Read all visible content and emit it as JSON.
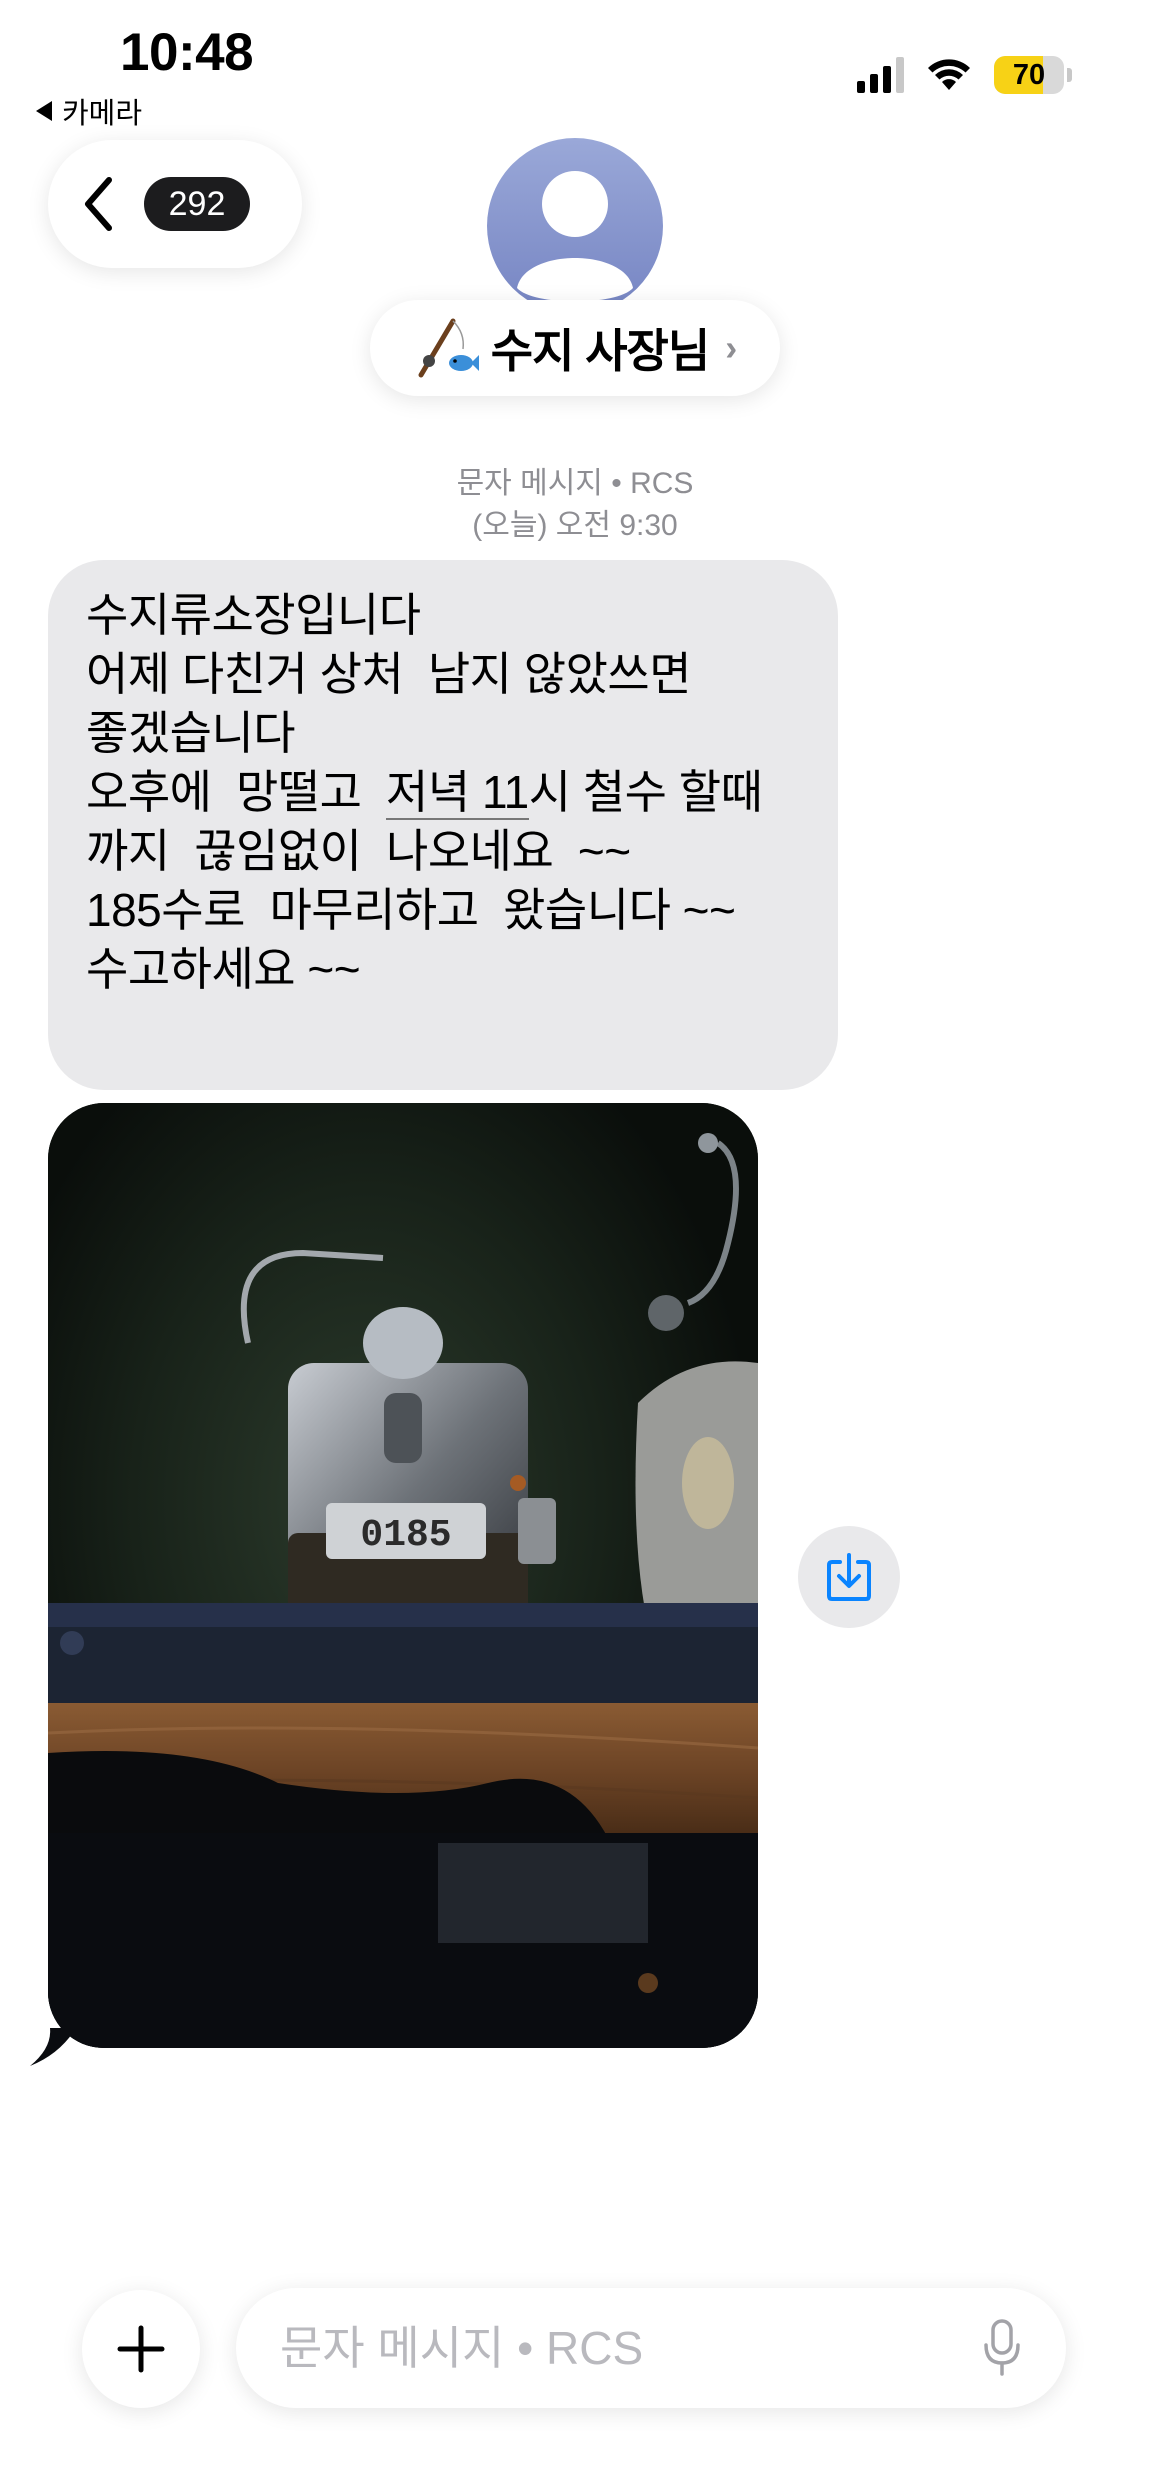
{
  "status_bar": {
    "time": "10:48",
    "back_app_label": "카메라",
    "battery_level": "70",
    "battery_percent": 70,
    "battery_color": "#f7d216",
    "signal_bars": 3,
    "icons": [
      "cellular-signal-icon",
      "wifi-icon",
      "battery-icon"
    ]
  },
  "header": {
    "unread_count": "292",
    "contact_name": "수지 사장님",
    "contact_emoji_icon": "fishing-pole-fish-emoji",
    "avatar_icon": "person-silhouette-icon"
  },
  "conversation": {
    "channel": "문자 메시지 • RCS",
    "timestamp": "(오늘) 오전 9:30",
    "messages": [
      {
        "type": "text",
        "lines": [
          "수지류소장입니다",
          "어제 다친거 상처  남지 않았쓰면",
          "좋겠습니다",
          "오후에  망떨고  ",
          "까지  끊임없이  나오네요  ~~",
          "185수로  마무리하고  왔습니다 ~~",
          "수고하세요 ~~"
        ],
        "line4_underlined": "저녁 11",
        "line4_rest": "시 철수 할때"
      },
      {
        "type": "image",
        "counter_display": "0185",
        "save_icon": "download-tray-icon"
      }
    ]
  },
  "composer": {
    "placeholder": "문자 메시지 • RCS",
    "plus_icon": "plus-icon",
    "mic_icon": "microphone-icon"
  },
  "colors": {
    "bubble_bg": "#e9e9eb",
    "accent": "#0a84ff",
    "meta_text": "#8e8e93"
  }
}
